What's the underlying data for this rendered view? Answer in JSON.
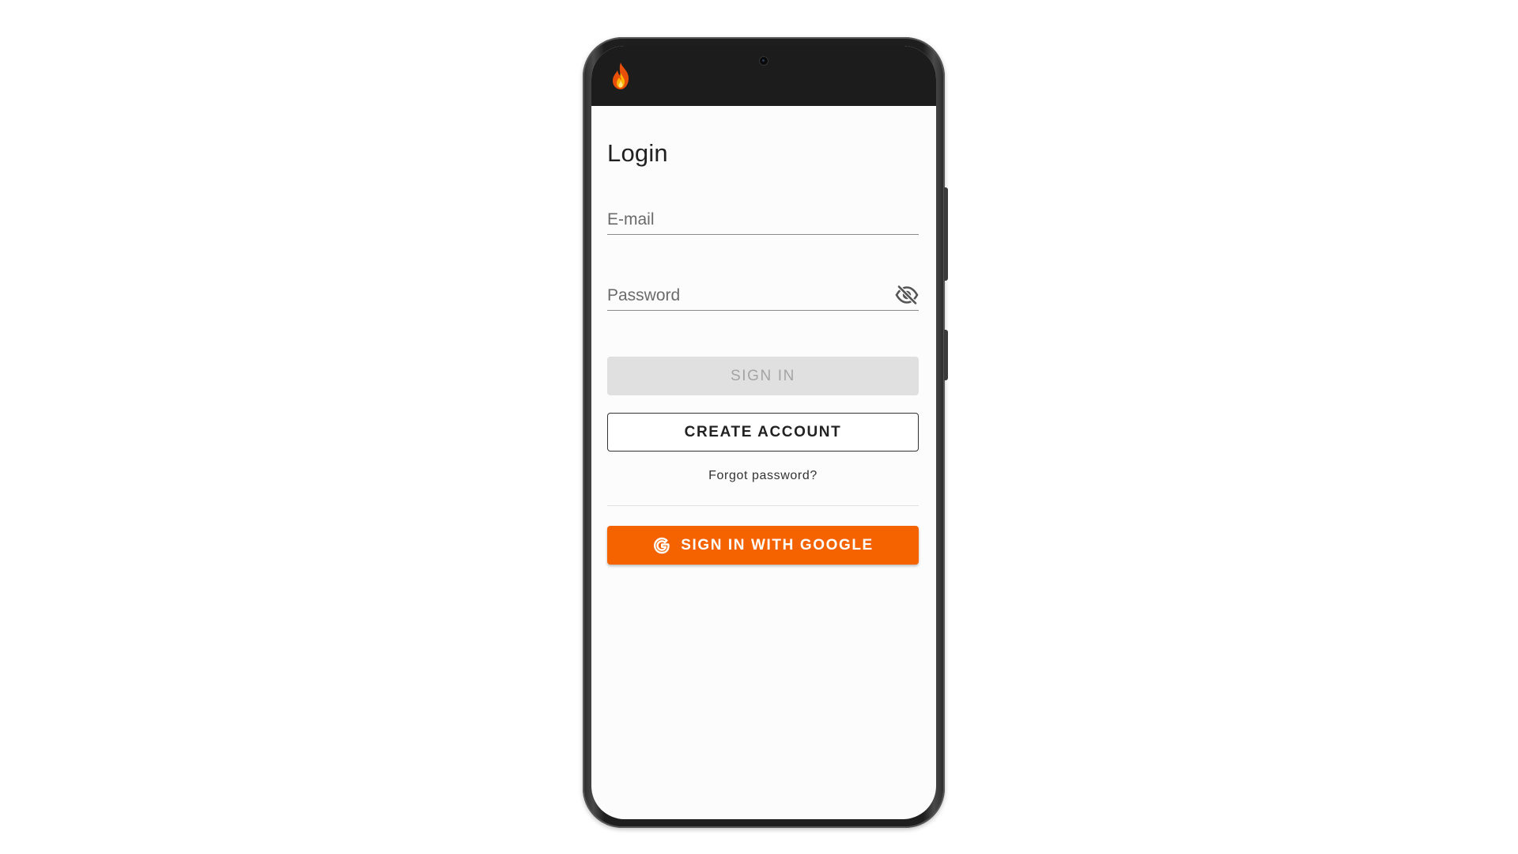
{
  "header": {
    "logo_icon": "flame-icon",
    "camera_icon": "camera-icon"
  },
  "login": {
    "title": "Login",
    "email": {
      "placeholder": "E-mail",
      "value": ""
    },
    "password": {
      "placeholder": "Password",
      "value": "",
      "visibility_icon": "eye-off-icon"
    },
    "sign_in_label": "SIGN IN",
    "sign_in_disabled": true,
    "create_account_label": "CREATE ACCOUNT",
    "forgot_password_label": "Forgot password?",
    "google_label": "SIGN IN WITH GOOGLE",
    "google_icon": "google-g-icon"
  },
  "colors": {
    "accent": "#f56200",
    "status_bar": "#1c1c1c",
    "disabled_bg": "#e0e0e0",
    "disabled_text": "#a4a4a4"
  }
}
